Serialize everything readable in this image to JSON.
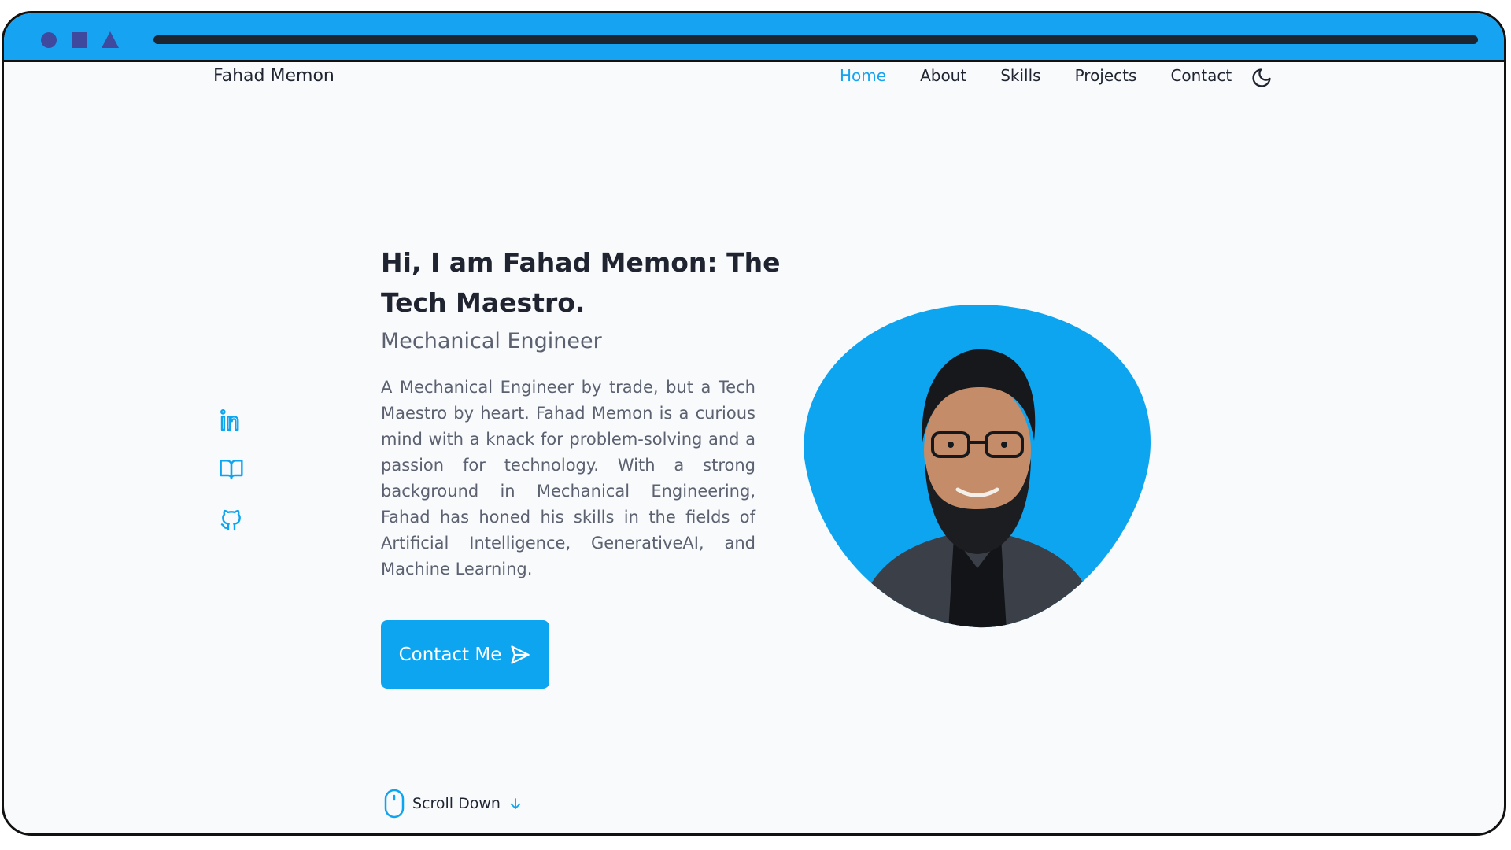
{
  "header": {
    "brand": "Fahad Memon",
    "nav": [
      {
        "label": "Home",
        "active": true
      },
      {
        "label": "About",
        "active": false
      },
      {
        "label": "Skills",
        "active": false
      },
      {
        "label": "Projects",
        "active": false
      },
      {
        "label": "Contact",
        "active": false
      }
    ],
    "theme_toggle_icon": "moon-icon"
  },
  "social": [
    {
      "icon": "linkedin-icon"
    },
    {
      "icon": "book-open-icon"
    },
    {
      "icon": "github-icon"
    }
  ],
  "hero": {
    "headline": "Hi, I am Fahad Memon: The Tech Maestro.",
    "subtitle": "Mechanical Engineer",
    "description": "A Mechanical Engineer by trade, but a Tech Maestro by heart. Fahad Memon is a curious mind with a knack for problem-solving and a passion for technology. With a strong background in Mechanical Engineering, Fahad has honed his skills in the fields of Artificial Intelligence, GenerativeAI, and Machine Learning.",
    "cta_label": "Contact Me",
    "cta_icon": "send-icon"
  },
  "scroll": {
    "label": "Scroll Down",
    "mouse_icon": "mouse-icon",
    "arrow_icon": "arrow-down-icon"
  },
  "colors": {
    "accent": "#0ea5f0",
    "browser_bar": "#16a4f2",
    "window_controls": "#3f4a9f",
    "text_dark": "#1f2430",
    "text_muted": "#5c6170"
  }
}
